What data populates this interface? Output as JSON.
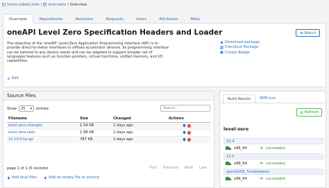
{
  "breadcrumb": {
    "home": "home:cabelo:intel",
    "project": "level-zero",
    "current": "Overview"
  },
  "tabs": [
    "Overview",
    "Repositories",
    "Revisions",
    "Requests",
    "Users",
    "Attributes",
    "Meta"
  ],
  "package": {
    "title": "oneAPI Level Zero Specification Headers and Loader",
    "description": "The objective of the 'oneAPI' Level-Zero Application Programming Interface (API) is to provide direct-to-metal interfaces to offload accelerator devices. Its programming interface can be tailored to any device needs and can be adapted to support broader set of languages features such as function pointers, virtual functions, unified memory, and I/O capabilities.",
    "edit_label": "Edit",
    "watch_label": "Watch",
    "actions": [
      "Download package",
      "Checkout Package",
      "Create Badge"
    ]
  },
  "source_files": {
    "header": "Source Files",
    "show_label": "Show",
    "show_value": "25",
    "entries_label": "entries",
    "search_placeholder": "Search...",
    "columns": [
      "Filename",
      "Size",
      "Changed",
      "Actions"
    ],
    "rows": [
      {
        "filename": "level-zero.changes",
        "size": "1.54 KB",
        "changed": "2 days ago"
      },
      {
        "filename": "level-zero.spec",
        "size": "1.98 KB",
        "changed": "2 days ago"
      },
      {
        "filename": "v1.10.0.tar.gz",
        "size": "787 KB",
        "changed": "2 days ago"
      }
    ],
    "info": "page 1 of 1 (5 records)",
    "pager": [
      "First",
      "Previous",
      "Next",
      "Last"
    ],
    "add_local": "Add local files",
    "add_empty": "Add an empty file or service"
  },
  "build": {
    "tabs": [
      "Build Results",
      "RPM Lint"
    ],
    "refresh_label": "Refresh",
    "project": "level-zero",
    "repos": [
      {
        "name": "15.4",
        "arch": "x86_64",
        "status": "succeeded"
      },
      {
        "name": "15.5",
        "arch": "x86_64",
        "status": "succeeded"
      },
      {
        "name": "openSUSE_Tumbleweed",
        "arch": "x86_64",
        "status": "succeeded"
      }
    ]
  },
  "colors": {
    "link": "#2a6ebb",
    "success": "#3c8d3c",
    "danger": "#c9302c"
  }
}
